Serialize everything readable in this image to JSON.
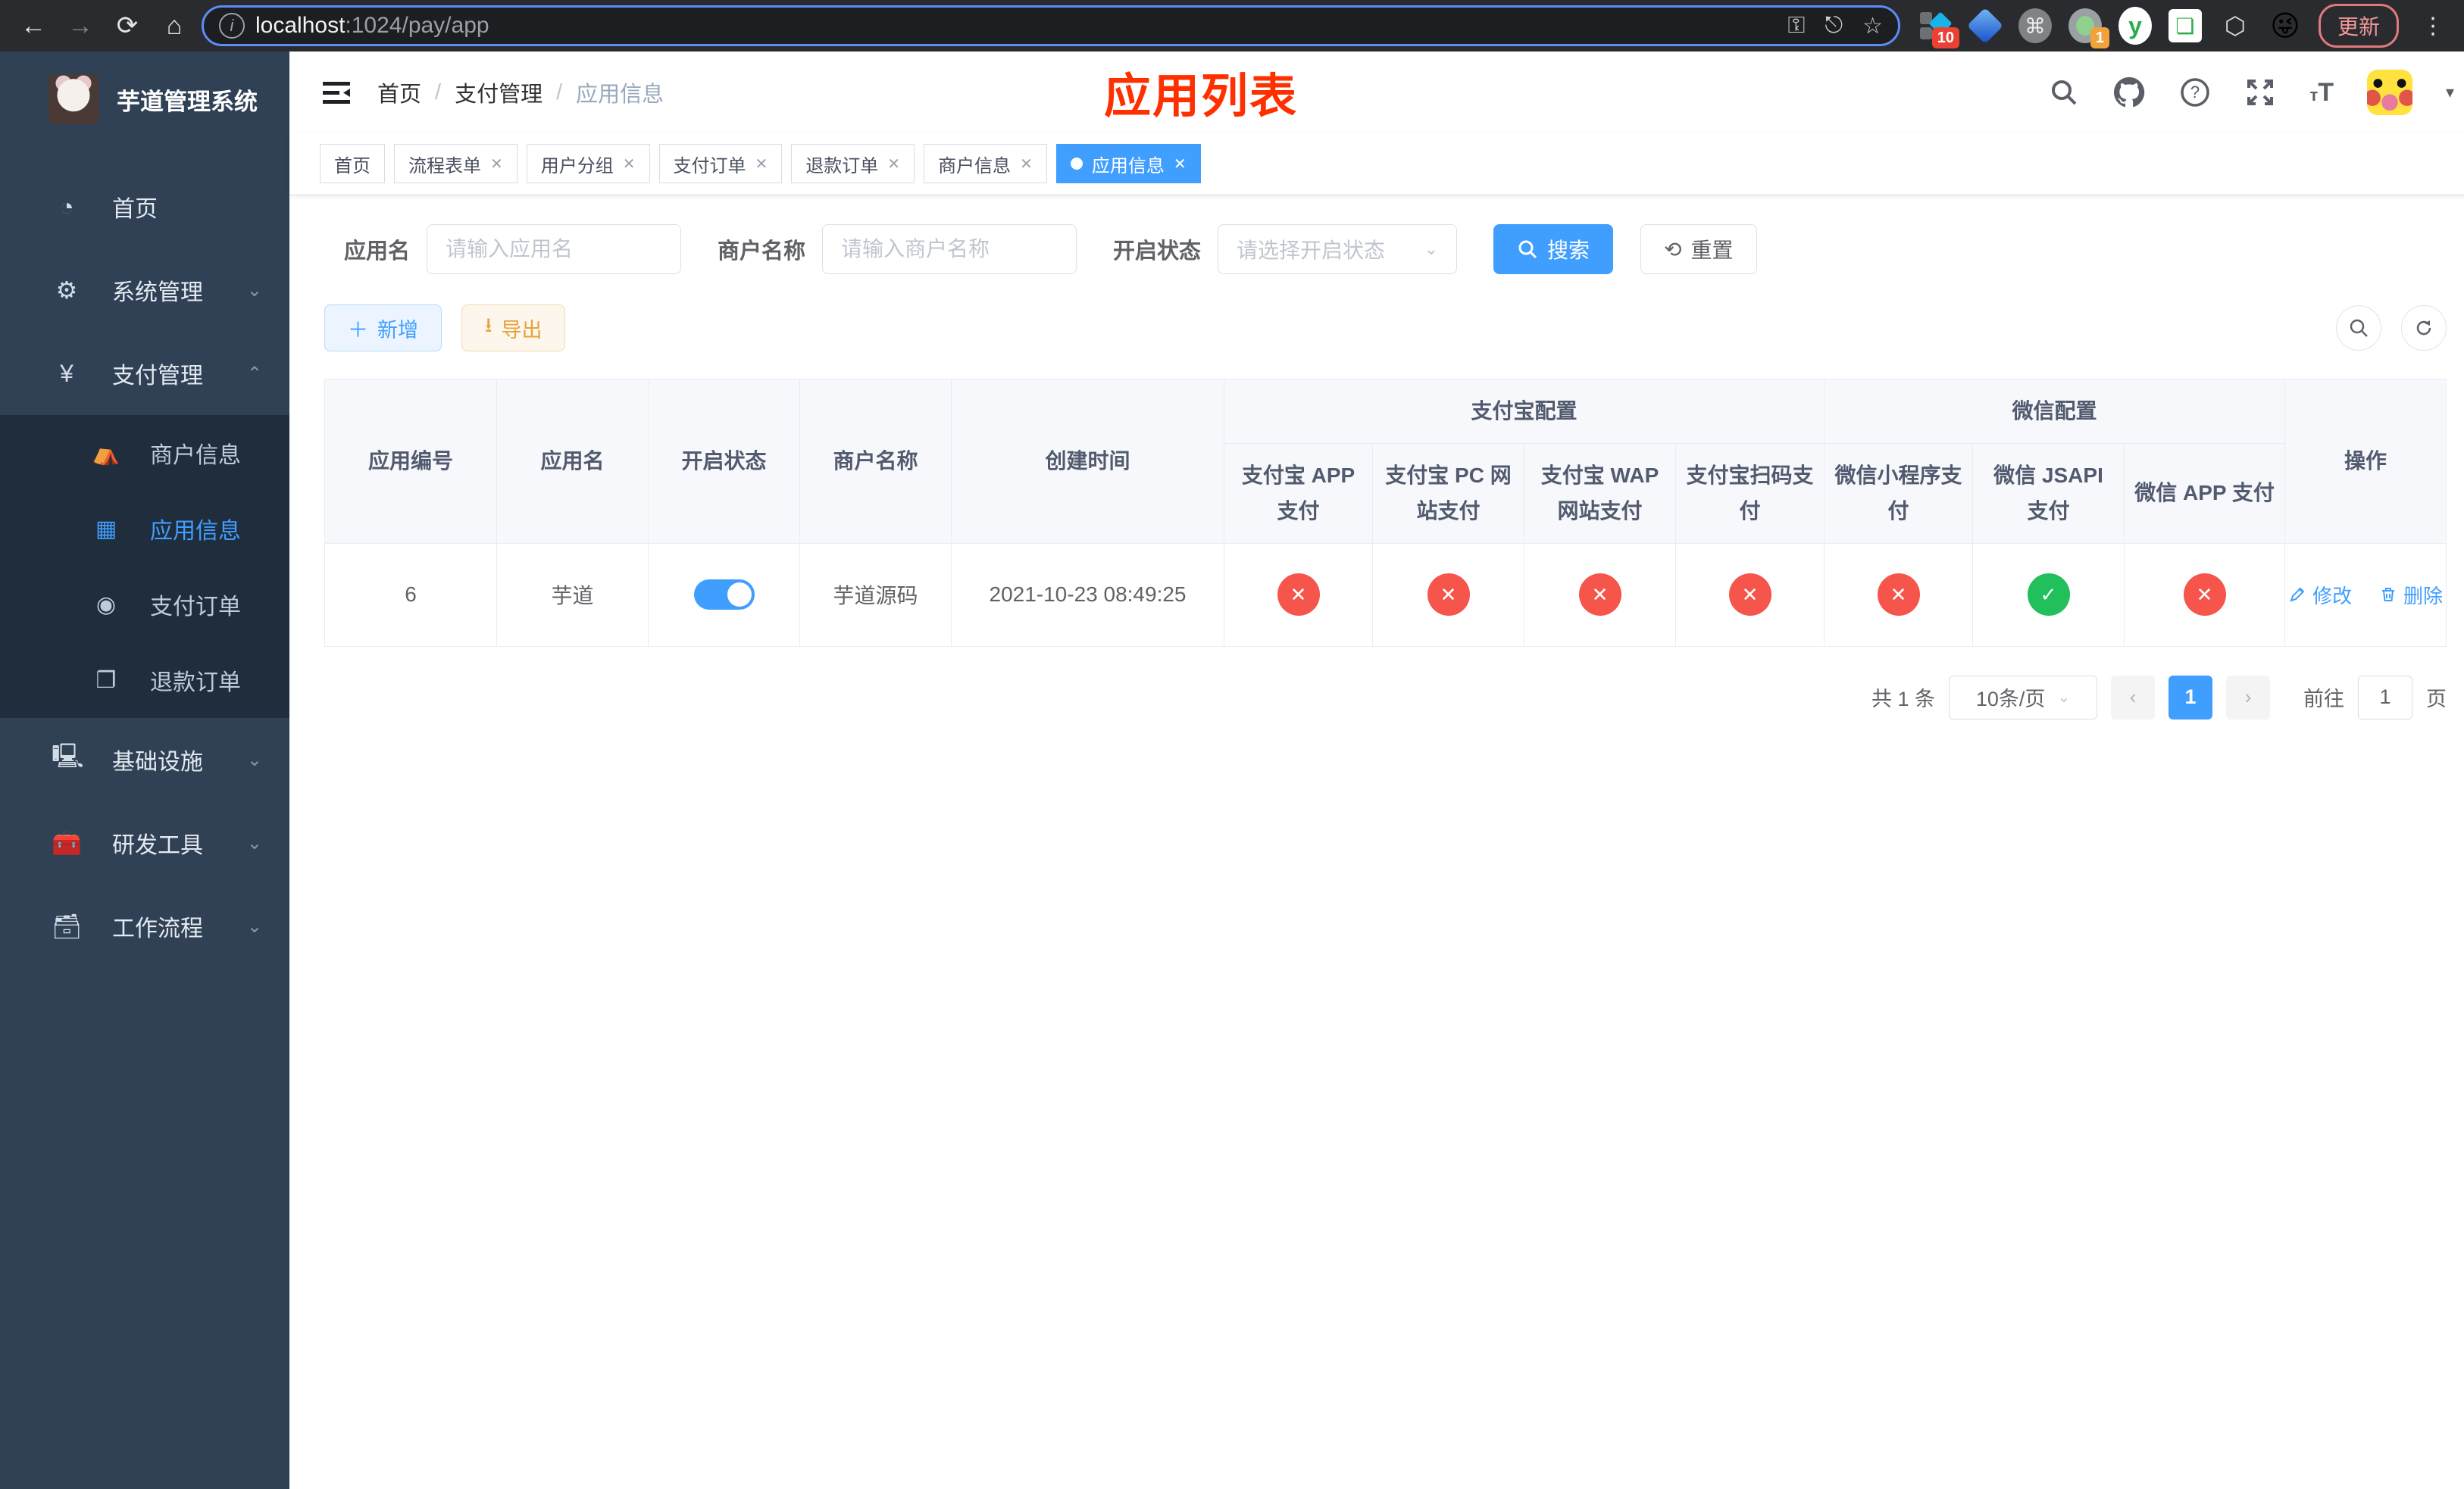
{
  "colors": {
    "accent": "#409eff",
    "status_off": "#f5554a",
    "status_on": "#21c05a",
    "annotation_red": "#ff3000",
    "sidebar_bg": "#304156",
    "submenu_bg": "#1f2d3d"
  },
  "icons": {
    "check": "✓",
    "cross": "✕",
    "chevron_down": "⌄",
    "chevron_up": "⌃",
    "plus": "＋",
    "download": "⇩",
    "search_glyph": "⌕"
  },
  "browser": {
    "url_host": "localhost",
    "url_rest": ":1024/pay/app",
    "update_label": "更新",
    "ext_badge_tampermonkey": "10",
    "ext_badge_recorder": "1"
  },
  "sidebar": {
    "title": "芋道管理系统",
    "items": [
      {
        "label": "首页"
      },
      {
        "label": "系统管理"
      },
      {
        "label": "支付管理"
      }
    ],
    "submenu": [
      {
        "label": "商户信息"
      },
      {
        "label": "应用信息"
      },
      {
        "label": "支付订单"
      },
      {
        "label": "退款订单"
      }
    ],
    "items_bottom": [
      {
        "label": "基础设施"
      },
      {
        "label": "研发工具"
      },
      {
        "label": "工作流程"
      }
    ]
  },
  "header": {
    "breadcrumb": [
      "首页",
      "支付管理",
      "应用信息"
    ],
    "annotation": "应用列表"
  },
  "tabs": [
    {
      "label": "首页"
    },
    {
      "label": "流程表单"
    },
    {
      "label": "用户分组"
    },
    {
      "label": "支付订单"
    },
    {
      "label": "退款订单"
    },
    {
      "label": "商户信息"
    },
    {
      "label": "应用信息"
    }
  ],
  "filters": {
    "app_name_label": "应用名",
    "app_name_placeholder": "请输入应用名",
    "merchant_label": "商户名称",
    "merchant_placeholder": "请输入商户名称",
    "status_label": "开启状态",
    "status_placeholder": "请选择开启状态",
    "search_label": "搜索",
    "reset_label": "重置"
  },
  "toolbar": {
    "add_label": "新增",
    "export_label": "导出"
  },
  "table": {
    "columns": [
      "应用编号",
      "应用名",
      "开启状态",
      "商户名称",
      "创建时间"
    ],
    "group_alipay": "支付宝配置",
    "group_wechat": "微信配置",
    "subcols": [
      "支付宝 APP 支付",
      "支付宝 PC 网站支付",
      "支付宝 WAP 网站支付",
      "支付宝扫码支付",
      "微信小程序支付",
      "微信 JSAPI 支付",
      "微信 APP 支付"
    ],
    "op_label": "操作",
    "row": {
      "id": "6",
      "name": "芋道",
      "enabled": true,
      "merchant": "芋道源码",
      "created": "2021-10-23 08:49:25",
      "channels": [
        false,
        false,
        false,
        false,
        false,
        true,
        false
      ],
      "edit_label": "修改",
      "delete_label": "删除"
    }
  },
  "pagination": {
    "total": "共 1 条",
    "page_size": "10条/页",
    "current": "1",
    "goto_prefix": "前往",
    "goto_value": "1",
    "goto_suffix": "页"
  }
}
